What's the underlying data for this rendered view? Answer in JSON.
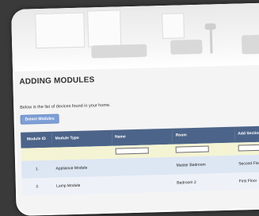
{
  "page": {
    "title": "ADDING MODULES",
    "intro": "Below is the list of devices found in your home.",
    "detect_button": "Detect Modules"
  },
  "table": {
    "headers": [
      "Module ID",
      "Module Type",
      "Name",
      "Room",
      "Add Section"
    ],
    "rows": [
      {
        "id": "1.",
        "type": "Appliance Module",
        "name": "",
        "room": "Master Bedroom",
        "section": "Second Floor"
      },
      {
        "id": "2.",
        "type": "Lamp Module",
        "name": "",
        "room": "Bedroom 2",
        "section": "First Floor"
      }
    ]
  },
  "colors": {
    "header_bg": "#4c6489",
    "filter_bg": "#f4f4d4",
    "row_bg": "#dde6f3",
    "button_bg": "#7e9fd6"
  }
}
